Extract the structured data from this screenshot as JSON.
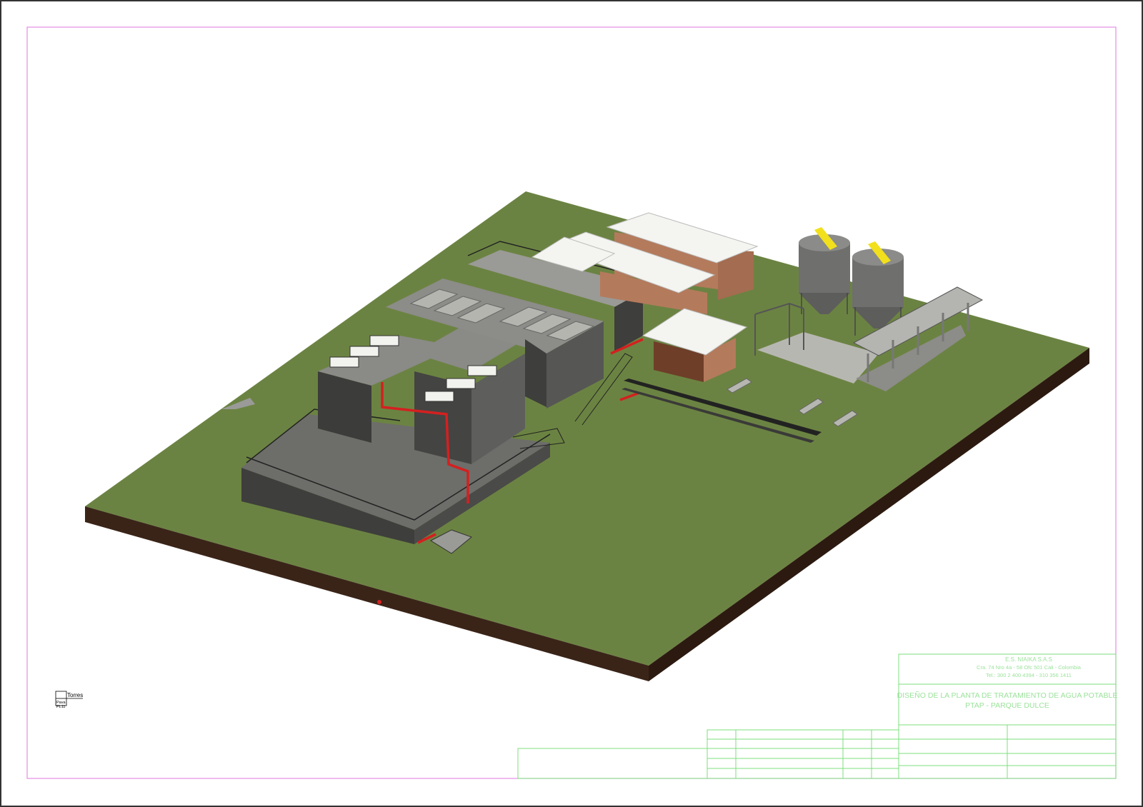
{
  "colors": {
    "border": "#e38ee3",
    "titleblock_lines": "#7ddf7d",
    "grass": "#6b8342",
    "soil": "#3a2418",
    "concrete": "#5a5a58",
    "concrete_light": "#8a8a86",
    "pipe_red": "#d42020",
    "roof_white": "#f4f4f0",
    "brick": "#b47a5c",
    "tank_grey": "#6f6f6d",
    "ladder_yellow": "#f1e01b"
  },
  "title_block": {
    "company_lines": [
      "E.S. NIAIKA S.A.S",
      "Cra. 74 Nro 4a - 58 Ofc 501 Cali - Colombia",
      "Tel.: 300 2 400 4394 - 310 356 1411"
    ],
    "project_line1": "DISEÑO DE LA PLANTA DE TRATAMIENTO DE AGUA POTABLE",
    "project_line2": "PTAP - PARQUE DULCE"
  },
  "view_tag": {
    "name": "Torres",
    "line2": "Pava",
    "line3": "PL11"
  },
  "icons": {
    "north_arrow": "north-arrow-icon",
    "view_tag": "section-tag-icon"
  }
}
